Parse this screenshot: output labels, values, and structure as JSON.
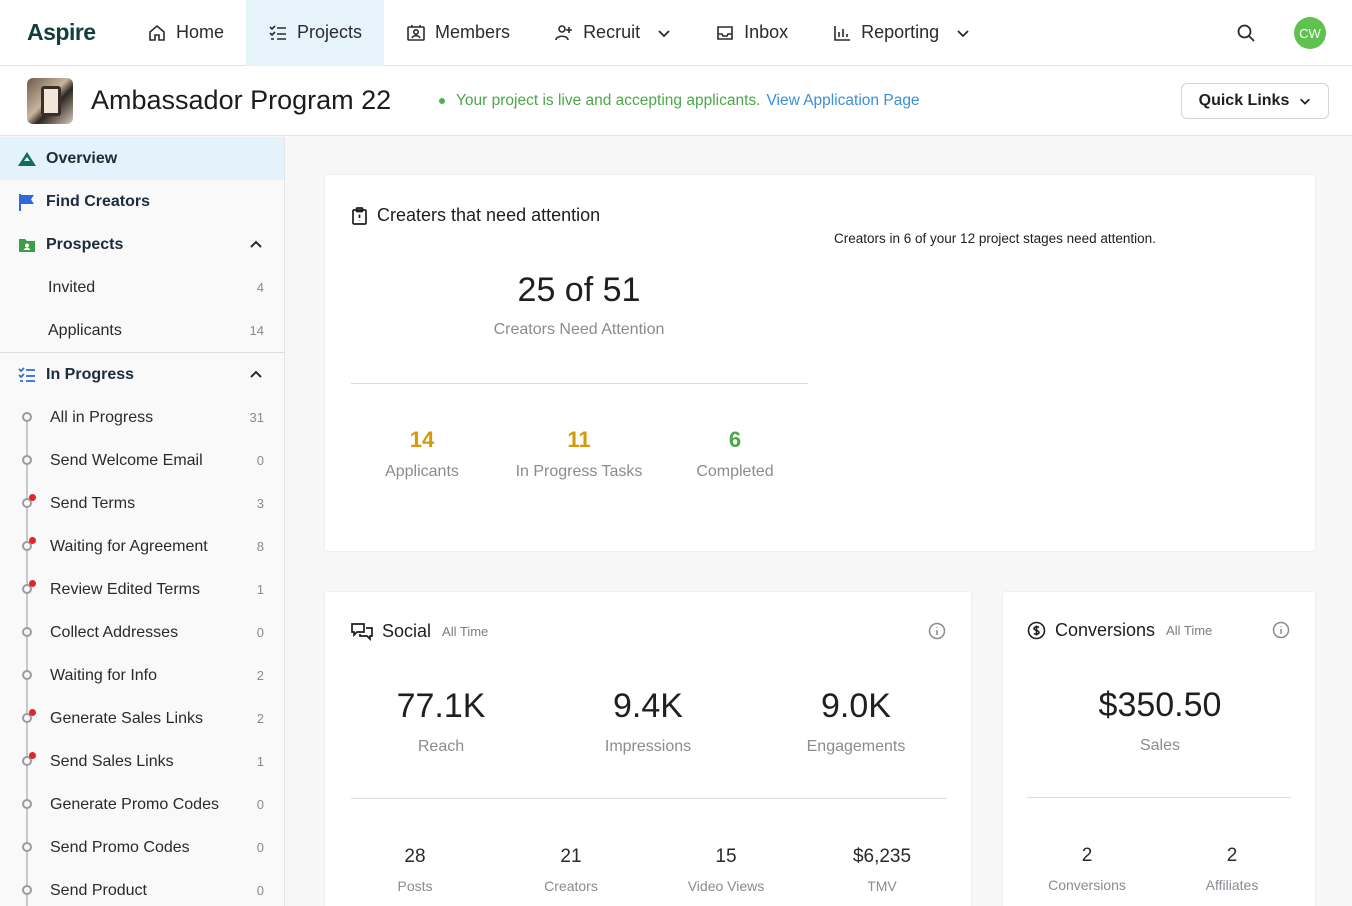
{
  "brand": {
    "logo": "Aspire",
    "accent": "#e6f3fb"
  },
  "nav": {
    "home": "Home",
    "projects": "Projects",
    "members": "Members",
    "recruit": "Recruit",
    "inbox": "Inbox",
    "reporting": "Reporting",
    "avatar_initials": "CW"
  },
  "project": {
    "title": "Ambassador Program 22",
    "status_text": "Your project is live and accepting applicants.",
    "status_link": "View Application Page",
    "quick_links": "Quick Links"
  },
  "sidebar": {
    "overview": "Overview",
    "find_creators": "Find Creators",
    "prospects": "Prospects",
    "prospects_items": [
      {
        "label": "Invited",
        "count": "4"
      },
      {
        "label": "Applicants",
        "count": "14"
      }
    ],
    "in_progress": "In Progress",
    "stages": [
      {
        "label": "All in Progress",
        "count": "31",
        "alert": false
      },
      {
        "label": "Send Welcome Email",
        "count": "0",
        "alert": false
      },
      {
        "label": "Send Terms",
        "count": "3",
        "alert": true
      },
      {
        "label": "Waiting for Agreement",
        "count": "8",
        "alert": true
      },
      {
        "label": "Review Edited Terms",
        "count": "1",
        "alert": true
      },
      {
        "label": "Collect Addresses",
        "count": "0",
        "alert": false
      },
      {
        "label": "Waiting for Info",
        "count": "2",
        "alert": false
      },
      {
        "label": "Generate Sales Links",
        "count": "2",
        "alert": true
      },
      {
        "label": "Send Sales Links",
        "count": "1",
        "alert": true
      },
      {
        "label": "Generate Promo Codes",
        "count": "0",
        "alert": false
      },
      {
        "label": "Send Promo Codes",
        "count": "0",
        "alert": false
      },
      {
        "label": "Send Product",
        "count": "0",
        "alert": false
      }
    ]
  },
  "attention": {
    "title": "Creaters that need attention",
    "note": "Creators in 6 of your 12 project stages need attention.",
    "big_value": "25 of 51",
    "big_label": "Creators Need Attention",
    "stats": [
      {
        "value": "14",
        "label": "Applicants",
        "color": "#d49a0c"
      },
      {
        "value": "11",
        "label": "In Progress Tasks",
        "color": "#d49a0c"
      },
      {
        "value": "6",
        "label": "Completed",
        "color": "#4aa847"
      }
    ]
  },
  "social": {
    "title": "Social",
    "range": "All Time",
    "metrics": [
      {
        "value": "77.1K",
        "label": "Reach"
      },
      {
        "value": "9.4K",
        "label": "Impressions"
      },
      {
        "value": "9.0K",
        "label": "Engagements"
      }
    ],
    "small": [
      {
        "value": "28",
        "label": "Posts"
      },
      {
        "value": "21",
        "label": "Creators"
      },
      {
        "value": "15",
        "label": "Video Views"
      },
      {
        "value": "$6,235",
        "label": "TMV"
      }
    ]
  },
  "conversions": {
    "title": "Conversions",
    "range": "All Time",
    "big_value": "$350.50",
    "big_label": "Sales",
    "small": [
      {
        "value": "2",
        "label": "Conversions"
      },
      {
        "value": "2",
        "label": "Affiliates"
      }
    ]
  }
}
